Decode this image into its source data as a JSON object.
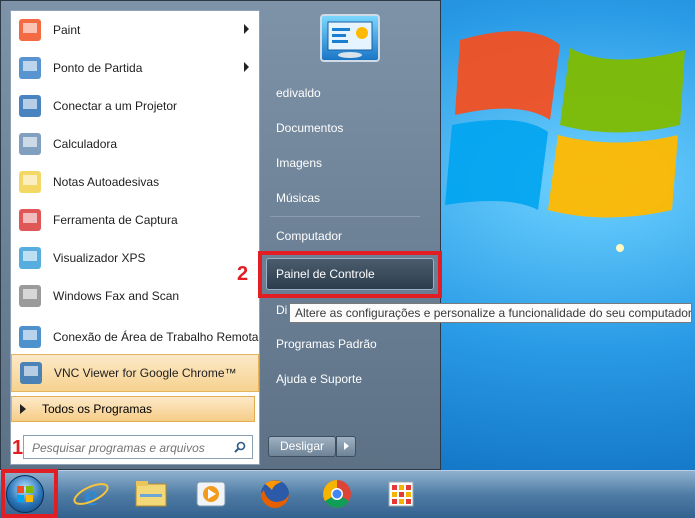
{
  "programs": [
    {
      "label": "Paint",
      "icon": "paint-icon",
      "has_arrow": true
    },
    {
      "label": "Ponto de Partida",
      "icon": "getting-started-icon",
      "has_arrow": true
    },
    {
      "label": "Conectar a um Projetor",
      "icon": "projector-icon",
      "has_arrow": false
    },
    {
      "label": "Calculadora",
      "icon": "calculator-icon",
      "has_arrow": false
    },
    {
      "label": "Notas Autoadesivas",
      "icon": "sticky-notes-icon",
      "has_arrow": false
    },
    {
      "label": "Ferramenta de Captura",
      "icon": "snipping-tool-icon",
      "has_arrow": false
    },
    {
      "label": "Visualizador XPS",
      "icon": "xps-viewer-icon",
      "has_arrow": false
    },
    {
      "label": "Windows Fax and Scan",
      "icon": "fax-scan-icon",
      "has_arrow": false
    },
    {
      "label": "Conexão de Área de Trabalho Remota",
      "icon": "remote-desktop-icon",
      "has_arrow": false
    },
    {
      "label": "VNC Viewer for Google Chrome™",
      "icon": "vnc-icon",
      "has_arrow": false
    }
  ],
  "all_programs_label": "Todos os Programas",
  "search": {
    "placeholder": "Pesquisar programas e arquivos"
  },
  "right_pane": {
    "user": "edivaldo",
    "documents": "Documentos",
    "images": "Imagens",
    "music": "Músicas",
    "computer": "Computador",
    "control_panel": "Painel de Controle",
    "devices_partial": "Di",
    "default_programs": "Programas Padrão",
    "help": "Ajuda e Suporte"
  },
  "shutdown_label": "Desligar",
  "tooltip": "Altere as configurações e personalize a funcionalidade do seu computador.",
  "markers": {
    "one": "1",
    "two": "2"
  },
  "colors": {
    "highlight_red": "#e01e24",
    "menu_bg": "#6d8196",
    "accent_orange": "#f6cd87"
  },
  "taskbar": [
    "start-orb",
    "internet-explorer-icon",
    "file-explorer-icon",
    "media-player-icon",
    "firefox-icon",
    "chrome-icon",
    "apps-grid-icon"
  ]
}
